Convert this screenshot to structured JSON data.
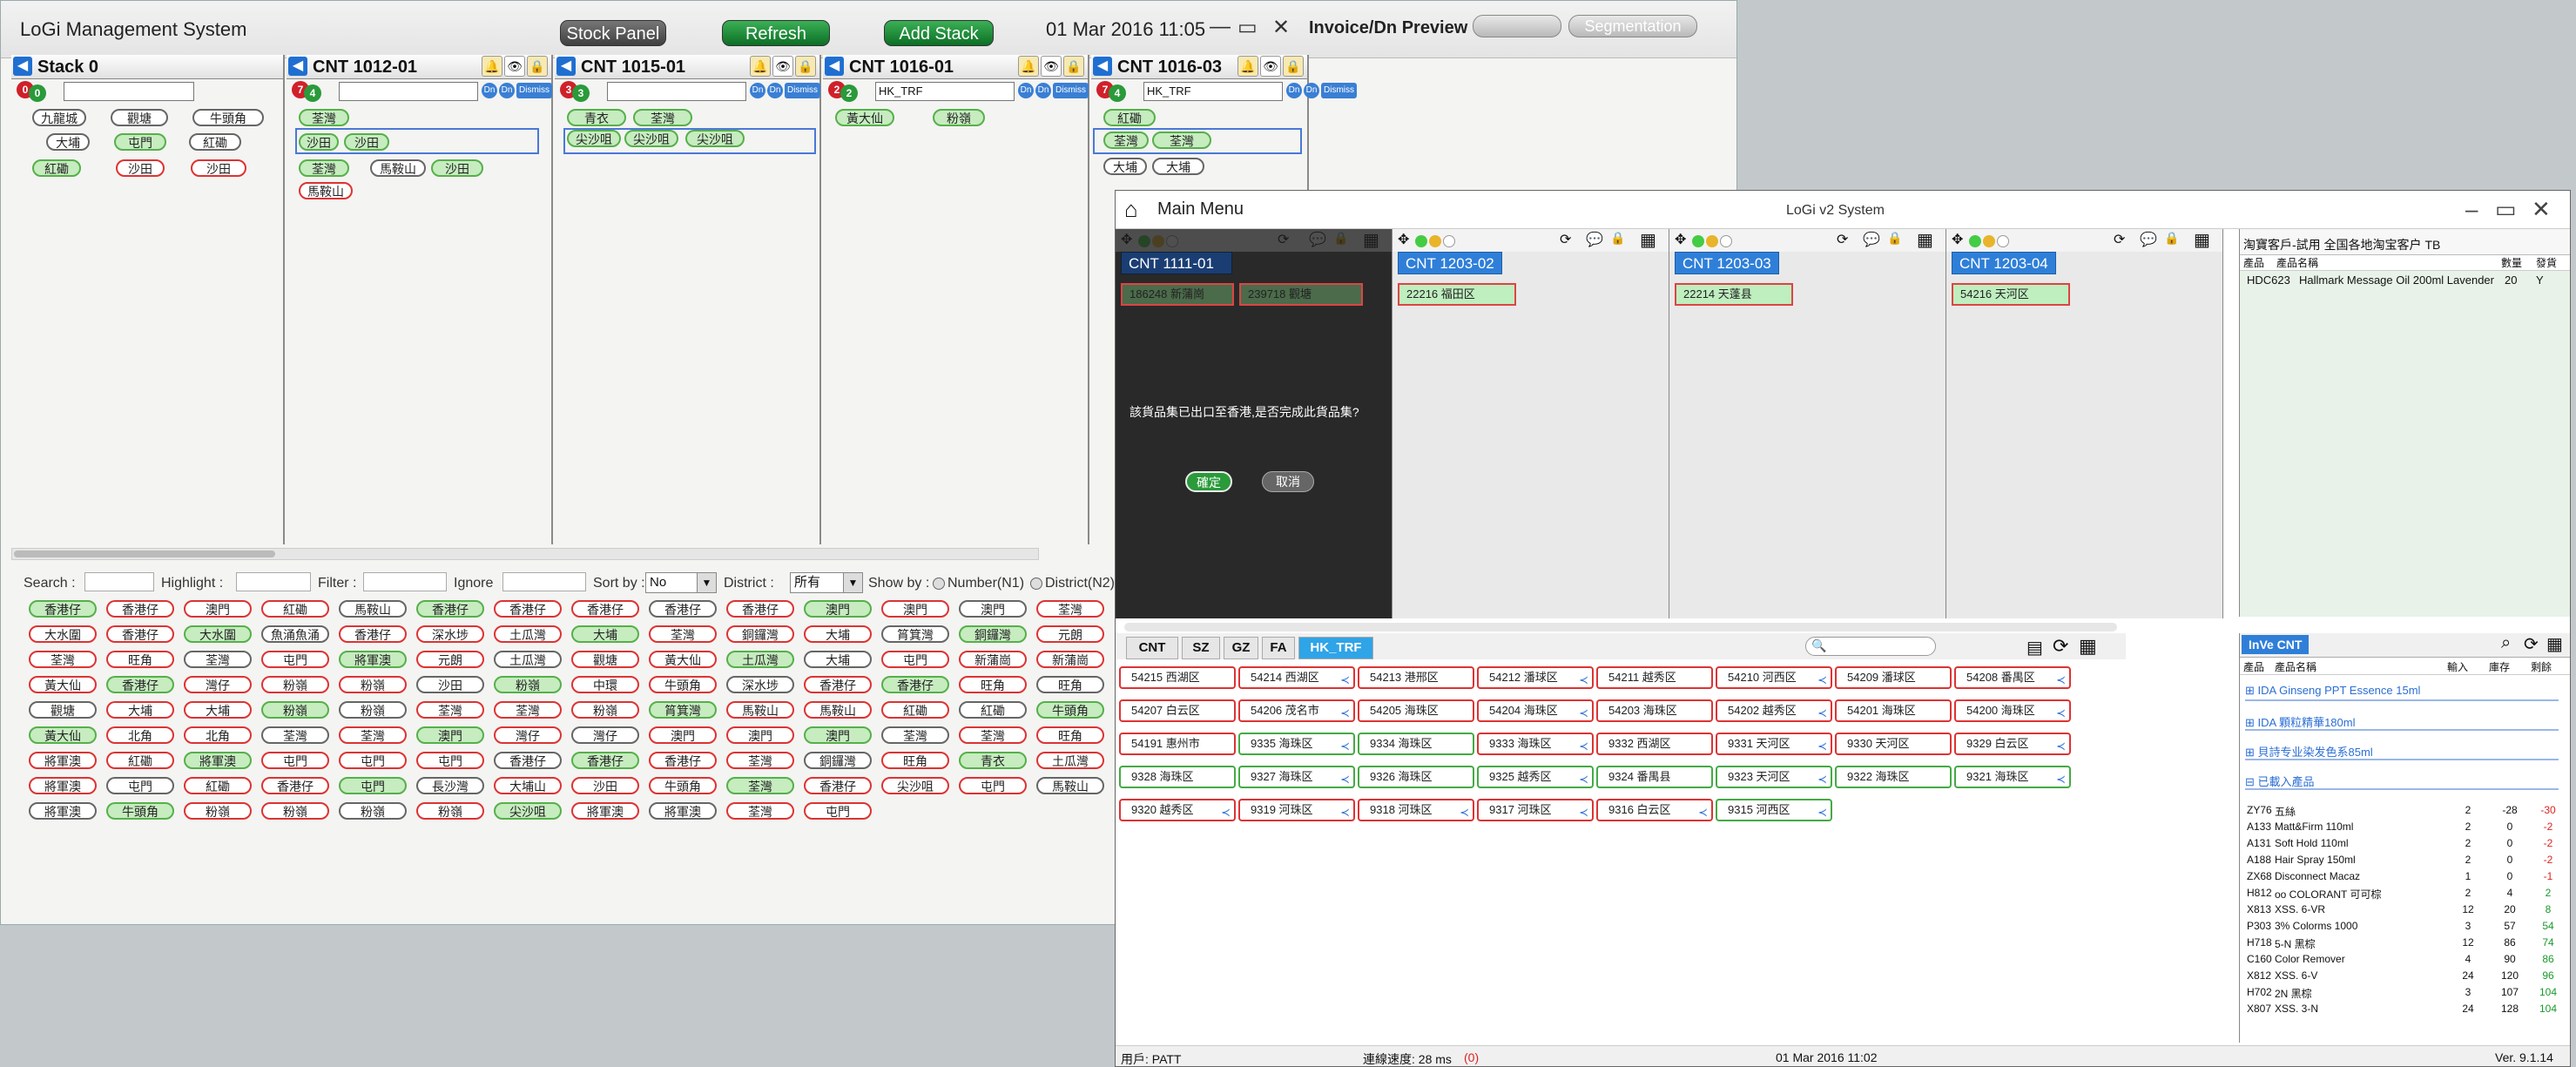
{
  "window1": {
    "title": "LoGi Management System",
    "buttons": {
      "stock_panel": "Stock Panel",
      "refresh": "Refresh",
      "add_stack": "Add Stack"
    },
    "clock": "01 Mar 2016 11:05",
    "invoice_preview": "Invoice/Dn Preview",
    "segmentation": "Segmentation",
    "stacks": [
      {
        "name": "Stack 0",
        "badge_red": "0",
        "badge_green": "0",
        "input": ""
      },
      {
        "name": "CNT  1012-01",
        "badge_red": "7",
        "badge_green": "4",
        "input": ""
      },
      {
        "name": "CNT  1015-01",
        "badge_red": "3",
        "badge_green": "3",
        "input": ""
      },
      {
        "name": "CNT  1016-01",
        "badge_red": "2",
        "badge_green": "2",
        "input": "HK_TRF"
      },
      {
        "name": "CNT  1016-03",
        "badge_red": "7",
        "badge_green": "4",
        "input": "HK_TRF"
      }
    ],
    "dismiss": "Dismiss",
    "stack_chips": [
      [
        "九龍城",
        "觀塘",
        "牛頭角",
        "大埔",
        "屯門",
        "紅磡",
        "紅磡",
        "沙田",
        "沙田"
      ],
      [
        "荃灣",
        "沙田",
        "沙田",
        "荃灣",
        "馬鞍山",
        "沙田",
        "馬鞍山"
      ],
      [
        "青衣",
        "荃灣",
        "尖沙咀",
        "尖沙咀",
        "尖沙咀"
      ],
      [
        "黃大仙",
        "粉嶺"
      ],
      [
        "紅磡",
        "荃灣",
        "荃灣",
        "大埔",
        "大埔"
      ]
    ],
    "filter": {
      "search": "Search :",
      "highlight": "Highlight :",
      "filter": "Filter :",
      "ignore": "Ignore",
      "sort_by": "Sort by :",
      "sort_value": "No",
      "district": "District :",
      "district_value": "所有",
      "show_by": "Show by :",
      "number": "Number(N1)",
      "district_opt": "District(N2)"
    },
    "grid": [
      [
        "香港仔",
        "香港仔",
        "澳門",
        "紅磡",
        "馬鞍山",
        "香港仔",
        "香港仔",
        "香港仔",
        "香港仔",
        "香港仔",
        "澳門",
        "澳門",
        "澳門",
        "荃灣"
      ],
      [
        "大水圍",
        "香港仔",
        "大水圍",
        "魚涌魚涌",
        "香港仔",
        "深水埗",
        "土瓜灣",
        "大埔",
        "荃灣",
        "銅鑼灣",
        "大埔",
        "筲箕灣",
        "銅鑼灣",
        "元朗"
      ],
      [
        "荃灣",
        "旺角",
        "荃灣",
        "屯門",
        "將軍澳",
        "元朗",
        "土瓜灣",
        "觀塘",
        "黃大仙",
        "土瓜灣",
        "大埔",
        "屯門",
        "新蒲崗",
        "新蒲崗"
      ],
      [
        "黃大仙",
        "香港仔",
        "灣仔",
        "粉嶺",
        "粉嶺",
        "沙田",
        "粉嶺",
        "中環",
        "牛頭角",
        "深水埗",
        "香港仔",
        "香港仔",
        "旺角",
        "旺角"
      ],
      [
        "觀塘",
        "大埔",
        "大埔",
        "粉嶺",
        "粉嶺",
        "荃灣",
        "荃灣",
        "粉嶺",
        "筲箕灣",
        "馬鞍山",
        "馬鞍山",
        "紅磡",
        "紅磡",
        "牛頭角"
      ],
      [
        "黃大仙",
        "北角",
        "北角",
        "荃灣",
        "荃灣",
        "澳門",
        "灣仔",
        "灣仔",
        "澳門",
        "澳門",
        "澳門",
        "荃灣",
        "荃灣",
        "旺角"
      ],
      [
        "將軍澳",
        "紅磡",
        "將軍澳",
        "屯門",
        "屯門",
        "屯門",
        "香港仔",
        "香港仔",
        "香港仔",
        "荃灣",
        "銅鑼灣",
        "旺角",
        "青衣",
        "土瓜灣"
      ],
      [
        "將軍澳",
        "屯門",
        "紅磡",
        "香港仔",
        "屯門",
        "長沙灣",
        "大埔山",
        "沙田",
        "牛頭角",
        "荃灣",
        "香港仔",
        "尖沙咀",
        "屯門",
        "馬鞍山"
      ],
      [
        "將軍澳",
        "牛頭角",
        "粉嶺",
        "粉嶺",
        "粉嶺",
        "粉嶺",
        "尖沙咀",
        "將軍澳",
        "將軍澳",
        "荃灣",
        "屯門"
      ]
    ]
  },
  "window2": {
    "main_menu": "Main Menu",
    "title": "LoGi v2 System",
    "panels": [
      {
        "cnt": "CNT  1111-01",
        "chips": [
          "186248 新蒲崗",
          "239718 觀塘"
        ]
      },
      {
        "cnt": "CNT  1203-02",
        "chips": [
          "22216 福田区"
        ]
      },
      {
        "cnt": "CNT  1203-03",
        "chips": [
          "22214 天蓬县"
        ]
      },
      {
        "cnt": "CNT  1203-04",
        "chips": [
          "54216 天河区"
        ]
      }
    ],
    "dialog": {
      "message": "該貨品集已出口至香港,是否完成此貨品集?",
      "ok": "確定",
      "cancel": "取消"
    },
    "tabs": [
      "CNT",
      "SZ",
      "GZ",
      "FA",
      "HK_TRF"
    ],
    "cells": [
      [
        "54215 西湖区",
        "54214 西湖区",
        "54213 港邢区",
        "54212 潘球区",
        "54211 越秀区",
        "54210 河西区",
        "54209 潘球区",
        "54208 番禺区"
      ],
      [
        "54207 白云区",
        "54206 茂名市",
        "54205 海珠区",
        "54204 海珠区",
        "54203 海珠区",
        "54202 越秀区",
        "54201 海珠区",
        "54200 海珠区"
      ],
      [
        "54191 惠州市",
        "9335 海珠区",
        "9334 海珠区",
        "9333 海珠区",
        "9332 西湖区",
        "9331 天河区",
        "9330 天河区",
        "9329 白云区"
      ],
      [
        "9328 海珠区",
        "9327 海珠区",
        "9326 海珠区",
        "9325 越秀区",
        "9324 番禺县",
        "9323 天河区",
        "9322 海珠区",
        "9321 海珠区"
      ],
      [
        "9320 越秀区",
        "9319 河珠区",
        "9318 河珠区",
        "9317 河珠区",
        "9316 白云区",
        "9315 河西区"
      ]
    ],
    "customer": {
      "header": "淘寶客戶-試用 全国各地淘宝客户  TB",
      "cols": [
        "產品",
        "產品名稱",
        "數量",
        "發貨"
      ],
      "rows": [
        [
          "HDC623",
          "Hallmark Message Oil 200ml Lavender",
          "20",
          "Y"
        ]
      ]
    },
    "inve": {
      "title": "InVe CNT",
      "cols": [
        "產品",
        "產品名稱",
        "輸入",
        "庫存",
        "剩餘"
      ],
      "groups": [
        "IDA Ginseng PPT Essence 15ml",
        "IDA 顆粒精華180ml",
        "貝詩专业染发色系85ml",
        "已載入產品"
      ],
      "rows": [
        [
          "ZY76",
          "五絲",
          "2",
          "-28",
          "-30"
        ],
        [
          "A133",
          "Matt&Firm 110ml",
          "2",
          "0",
          "-2"
        ],
        [
          "A131",
          "Soft Hold 110ml",
          "2",
          "0",
          "-2"
        ],
        [
          "A188",
          "Hair Spray 150ml",
          "2",
          "0",
          "-2"
        ],
        [
          "ZX68",
          "Disconnect Macaz",
          "1",
          "0",
          "-1"
        ],
        [
          "H812",
          "oo COLORANT 可可棕",
          "2",
          "4",
          "2"
        ],
        [
          "X813",
          "XSS. 6-VR",
          "12",
          "20",
          "8"
        ],
        [
          "P303",
          "3% Colorms 1000",
          "3",
          "57",
          "54"
        ],
        [
          "H718",
          "5-N 黑棕",
          "12",
          "86",
          "74"
        ],
        [
          "C160",
          "Color Remover",
          "4",
          "90",
          "86"
        ],
        [
          "X812",
          "XSS. 6-V",
          "24",
          "120",
          "96"
        ],
        [
          "H702",
          "2N 黑棕",
          "3",
          "107",
          "104"
        ],
        [
          "X807",
          "XSS. 3-N",
          "24",
          "128",
          "104"
        ]
      ]
    },
    "status": {
      "user": "用戶: PATT",
      "speed": "連線速度: 28 ms",
      "speed_flag": "(0)",
      "time": "01 Mar 2016 11:02",
      "version": "Ver. 9.1.14"
    }
  }
}
